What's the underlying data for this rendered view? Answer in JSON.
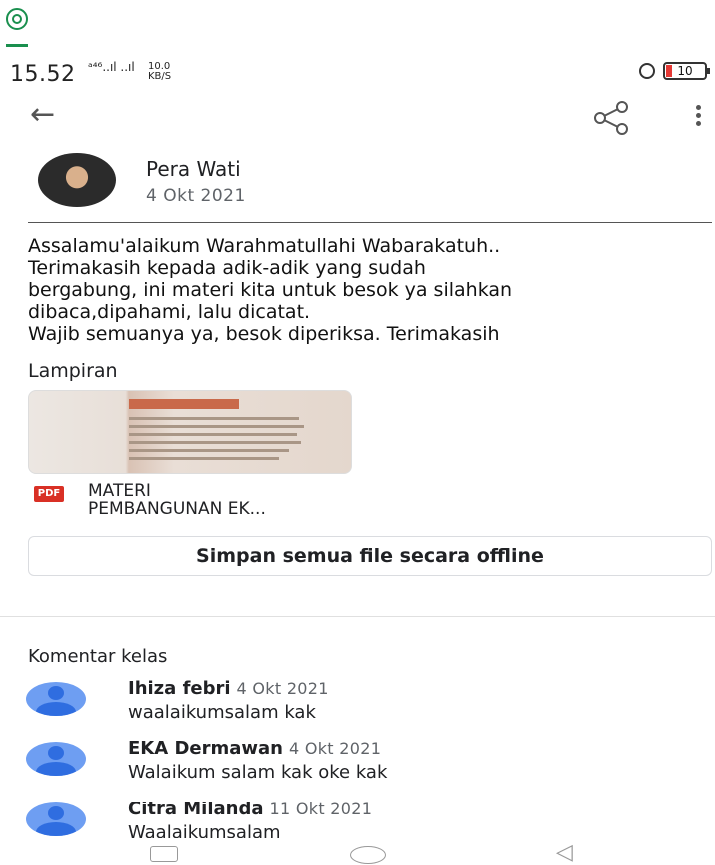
{
  "status_bar": {
    "time": "15.52",
    "signal_text": "ᵃ⁴⁶..ıl ..ıl",
    "speed_value": "10.0",
    "speed_unit": "KB/S",
    "battery": "10"
  },
  "header": {
    "back_icon": "arrow-left-icon",
    "share_icon": "share-icon",
    "more_icon": "more-vert-icon"
  },
  "post": {
    "author": "Pera Wati",
    "date": "4 Okt 2021",
    "body": "Assalamu'alaikum Warahmatullahi Wabarakatuh..\nTerimakasih kepada adik-adik yang sudah\nbergabung, ini materi kita untuk besok ya silahkan\ndibaca,dipahami, lalu dicatat.\nWajib semuanya ya, besok diperiksa. Terimakasih"
  },
  "attachments": {
    "title": "Lampiran",
    "file_type": "PDF",
    "file_name_line1": "MATERI",
    "file_name_line2": "PEMBANGUNAN EK...",
    "save_offline_label": "Simpan semua file secara offline"
  },
  "comments": {
    "title": "Komentar kelas",
    "items": [
      {
        "name": "Ihiza febri",
        "date": "4 Okt 2021",
        "text": "waalaikumsalam kak"
      },
      {
        "name": "EKA Dermawan",
        "date": "4 Okt 2021",
        "text": "Walaikum salam kak oke kak"
      },
      {
        "name": "Citra Milanda",
        "date": "11 Okt 2021",
        "text": "Waalaikumsalam"
      }
    ]
  },
  "colors": {
    "accent_green": "#1a8f4e",
    "pdf_red": "#d93025",
    "avatar_blue": "#6e9ef2"
  }
}
